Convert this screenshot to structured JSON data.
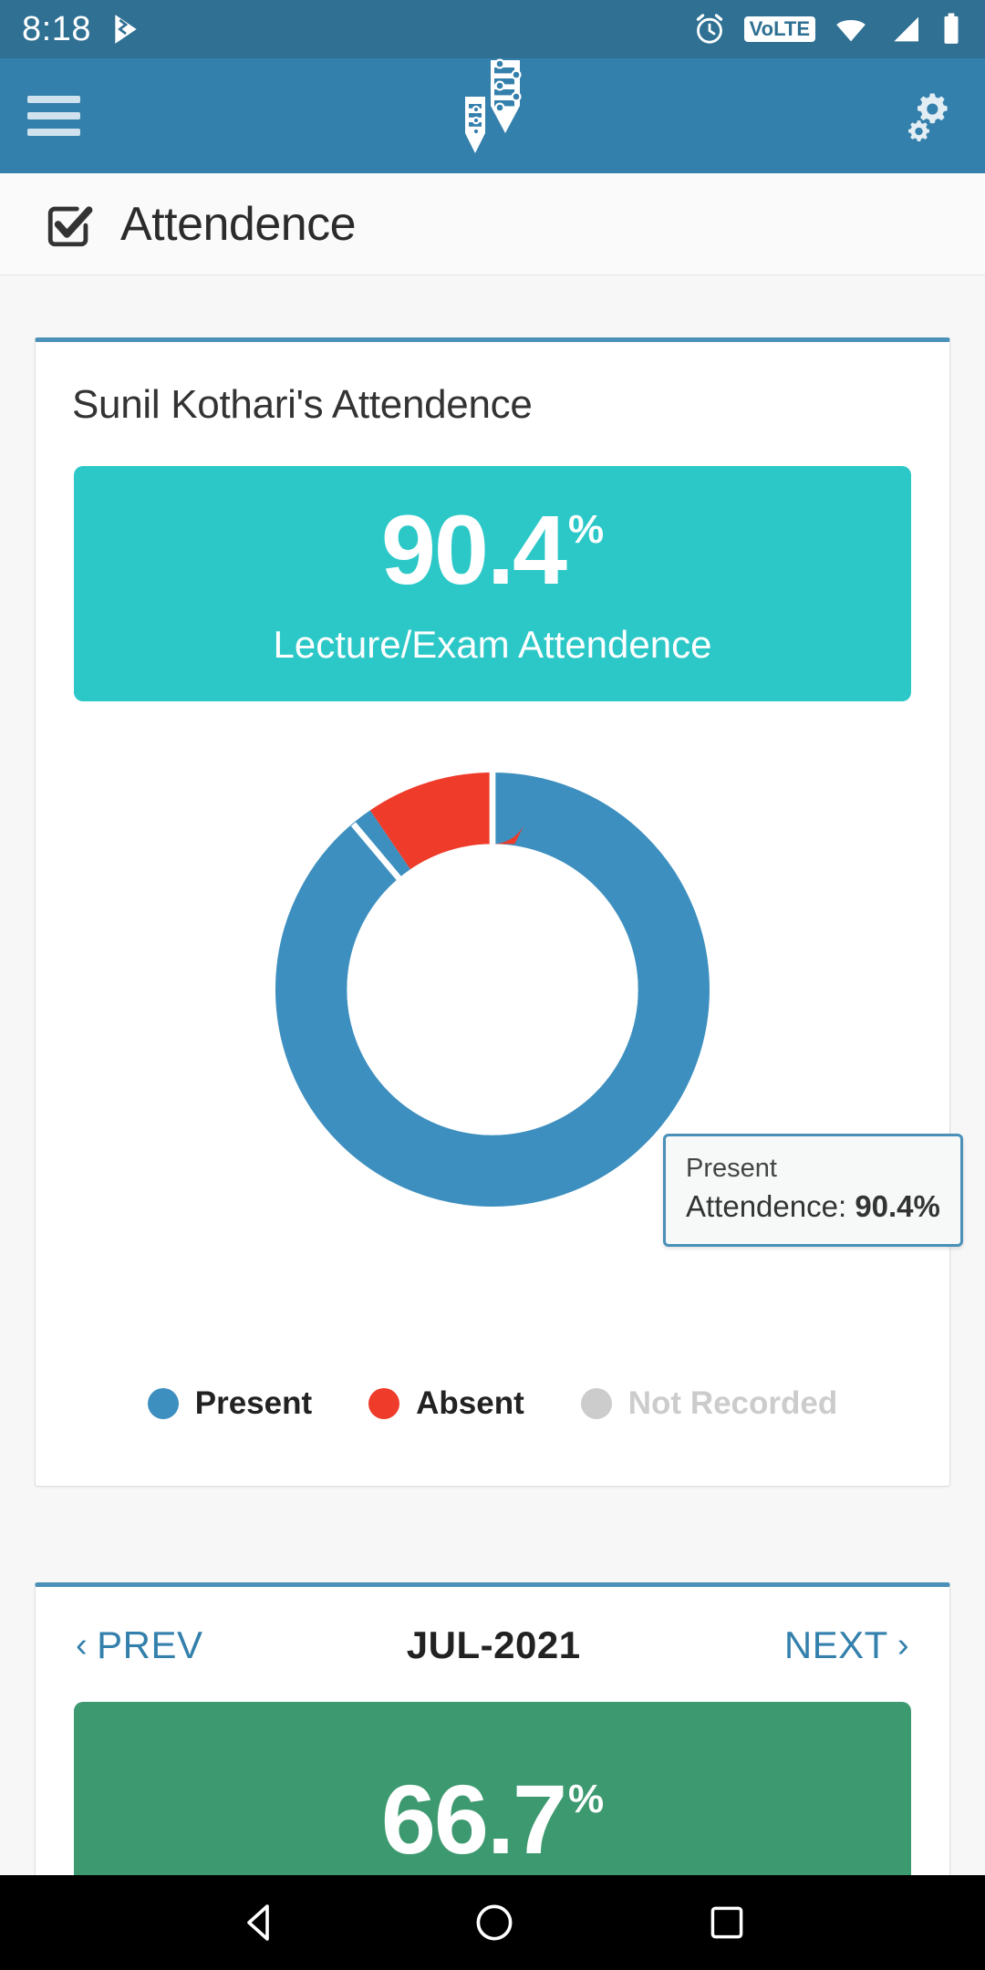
{
  "statusbar": {
    "time": "8:18",
    "icons": [
      "play-store-icon",
      "alarm-icon",
      "volte-icon",
      "wifi-icon",
      "signal-icon",
      "battery-icon"
    ],
    "volte_label": "VoLTE",
    "background": "#2f7093"
  },
  "appbar": {
    "menu_icon": "hamburger-menu-icon",
    "logo_icon": "app-logo-icon",
    "settings_icon": "gear-settings-icon",
    "background": "#3480ac"
  },
  "page": {
    "title": "Attendence",
    "title_icon": "checkbox-edit-icon"
  },
  "attendance_card": {
    "title": "Sunil Kothari's Attendence",
    "banner": {
      "value": "90.4",
      "percent_sign": "%",
      "caption": "Lecture/Exam Attendence",
      "color": "#2cc8c8"
    },
    "tooltip": {
      "line1": "Present",
      "label": "Attendence: ",
      "value": "90.4%"
    },
    "legend": [
      {
        "label": "Present",
        "color": "#3d8fbf",
        "active": true
      },
      {
        "label": "Absent",
        "color": "#ee3b2a",
        "active": true
      },
      {
        "label": "Not Recorded",
        "color": "#cccccc",
        "active": false
      }
    ]
  },
  "month_card": {
    "prev_label": "PREV",
    "prev_chevron": "‹",
    "next_label": "NEXT",
    "next_chevron": "›",
    "month": "JUL-2021",
    "banner": {
      "value": "66.7",
      "percent_sign": "%",
      "color": "#3d9970"
    }
  },
  "navbar": {
    "back_icon": "back-triangle-icon",
    "home_icon": "home-circle-icon",
    "recents_icon": "recents-square-icon"
  },
  "chart_data": {
    "type": "pie",
    "title": "Sunil Kothari's Attendence",
    "subtype": "donut",
    "categories": [
      "Present",
      "Absent",
      "Not Recorded"
    ],
    "values": [
      90.4,
      9.6,
      0
    ],
    "colors": [
      "#3d8fbf",
      "#ee3b2a",
      "#cccccc"
    ],
    "unit": "%",
    "legend_position": "bottom",
    "inner_radius_ratio": 0.62,
    "start_angle": 0,
    "direction": "clockwise",
    "annotations": [
      "Present",
      "Attendence: 90.4%"
    ]
  }
}
